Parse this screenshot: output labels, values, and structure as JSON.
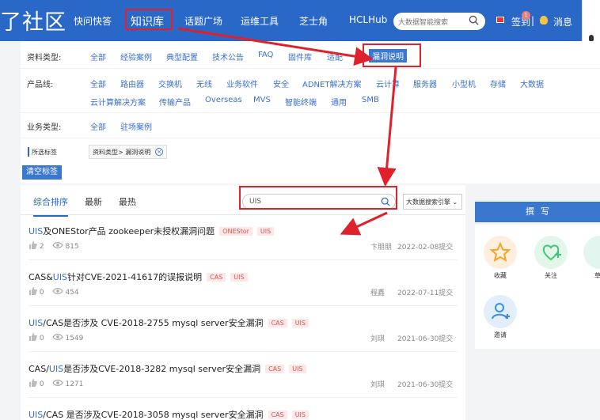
{
  "nav": {
    "logo": "了社区",
    "items": [
      "快问快答",
      "话题广场",
      "运维工具",
      "芝士角",
      "HCLHub"
    ],
    "active": "知识库",
    "search_placeholder": "大数据智能搜索",
    "signin": "签到",
    "signin_badge": "1",
    "messages": "消息"
  },
  "filters": {
    "type_label": "资料类型:",
    "types": [
      "全部",
      "经验案例",
      "典型配置",
      "技术公告",
      "FAQ",
      "固件库",
      "适配",
      "漏洞说明"
    ],
    "product_label": "产品线:",
    "products_row1": [
      "全部",
      "路由器",
      "交换机",
      "无线",
      "业务软件",
      "安全",
      "ADNET解决方案",
      "云计算",
      "服务器",
      "小型机",
      "存储",
      "大数据"
    ],
    "products_row2": [
      "云计算解决方案",
      "传输产品",
      "Overseas",
      "MVS",
      "智能终端",
      "通用",
      "SMB"
    ],
    "business_label": "业务类型:",
    "business": [
      "全部",
      "驻场案例"
    ],
    "selected_label": "所选标签",
    "selected_tag": "资料类型>  漏洞说明",
    "clear": "清空标签"
  },
  "results": {
    "tabs": [
      "综合排序",
      "最新",
      "最热"
    ],
    "search_value": "UIS",
    "engine": "大数据搜索引擎",
    "items": [
      {
        "pre": "",
        "hl": "UIS",
        "post": "及ONEStor产品 zookeeper未授权漏洞问题",
        "tags": [
          "ONEStor",
          "UIS"
        ],
        "likes": "2",
        "views": "815",
        "author": "卞朋朋",
        "date": "2022-02-08提交"
      },
      {
        "pre": "CAS&",
        "hl": "UIS",
        "post": "针对CVE-2021-41617的误报说明",
        "tags": [
          "CAS",
          "UIS"
        ],
        "likes": "0",
        "views": "454",
        "author": "程鑫",
        "date": "2022-07-11提交"
      },
      {
        "pre": "",
        "hl": "UIS",
        "post": "/CAS是否涉及 CVE-2018-2755 mysql server安全漏洞",
        "tags": [
          "CAS",
          "UIS"
        ],
        "likes": "0",
        "views": "1549",
        "author": "刘琪",
        "date": "2021-06-30提交"
      },
      {
        "pre": "CAS/",
        "hl": "UIS",
        "post": "是否涉及CVE-2018-3282 mysql server安全漏洞",
        "tags": [
          "CAS",
          "UIS"
        ],
        "likes": "0",
        "views": "1271",
        "author": "刘琪",
        "date": "2021-06-30提交"
      },
      {
        "pre": "",
        "hl": "UIS",
        "post": "/CAS 是否涉及CVE-2018-3058 mysql server安全漏洞",
        "tags": [
          "CAS",
          "UIS"
        ],
        "likes": "",
        "views": "",
        "author": "",
        "date": ""
      }
    ]
  },
  "side": {
    "write": "撰写",
    "actions": [
      {
        "label": "收藏",
        "icon": "star-icon",
        "color": "#f5a623"
      },
      {
        "label": "关注",
        "icon": "heart-plus-icon",
        "color": "#3fc37a"
      },
      {
        "label": "草",
        "icon": "draft-icon",
        "color": "#39c29a"
      },
      {
        "label": "邀请",
        "icon": "invite-user-icon",
        "color": "#3a8fe0"
      }
    ]
  }
}
